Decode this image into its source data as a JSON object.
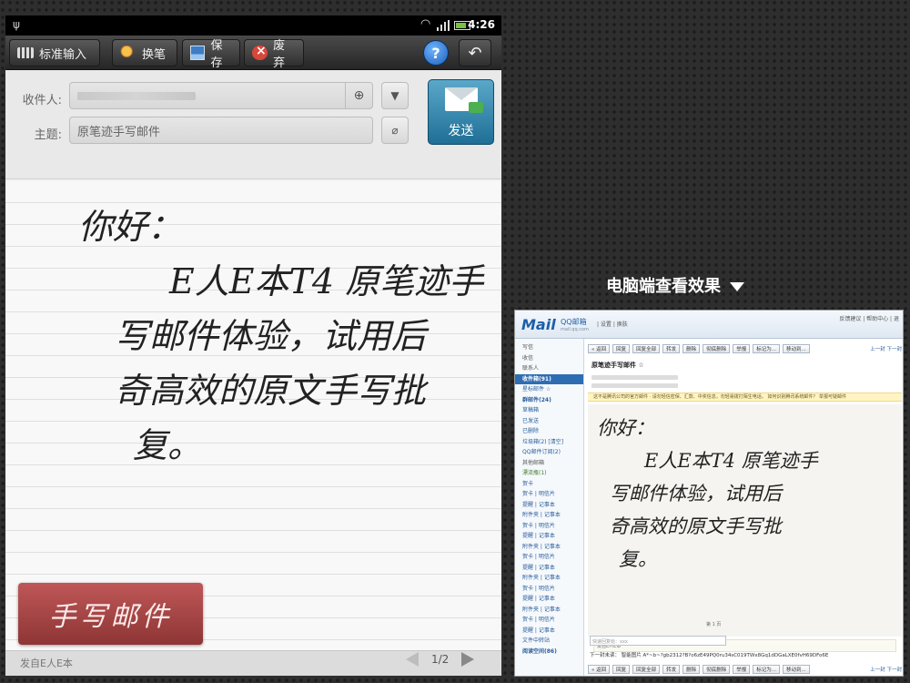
{
  "status_bar": {
    "time": "4:26"
  },
  "toolbar": {
    "input_mode": "标准输入",
    "change_pen": "换笔",
    "save": "保存",
    "discard": "废弃",
    "help": "?"
  },
  "compose": {
    "to_label": "收件人:",
    "subject_label": "主题:",
    "subject_value": "原笔迹手写邮件",
    "send_label": "发送"
  },
  "handwriting": {
    "lines": [
      "你好：",
      "E人E本T4 原笔迹手",
      "写邮件体验，试用后",
      "奇高效的原文手写批",
      "复。"
    ]
  },
  "badge": "手写邮件",
  "footer": {
    "signature": "发自E人E本",
    "page": "1/2"
  },
  "caption": "电脑端查看效果",
  "pc_view": {
    "logo": "Mail",
    "logo_sub": "QQ邮箱",
    "logo_url": "mail.qq.com",
    "top_links": "| 设置 | 换肤",
    "top_right": "反馈建议 | 帮助中心 | 退",
    "sidebar": {
      "compose": "写信",
      "receive": "收信",
      "contacts": "联系人",
      "inbox": "收件箱(91)",
      "starred": "星标邮件 ☆",
      "group": "群邮件(24)",
      "drafts": "草稿箱",
      "sent": "已发送",
      "deleted": "已删除",
      "spam": "垃圾箱(2)",
      "spam_clear": "[清空]",
      "subscriptions": "QQ邮件订阅(2)",
      "other": "其他邮箱",
      "notes": "漂流瓶(1)",
      "greeting": "贺卡",
      "filetrans": "文件中转站",
      "reading": "阅读空间(86)",
      "repeat_items": [
        "贺卡 | 明信片",
        "提醒 | 记事本",
        "附件夹 | 记事本",
        "贺卡 | 明信片",
        "提醒 | 记事本",
        "附件夹 | 记事本",
        "贺卡 | 明信片",
        "提醒 | 记事本",
        "附件夹 | 记事本",
        "贺卡 | 明信片",
        "提醒 | 记事本",
        "附件夹 | 记事本",
        "贺卡 | 明信片",
        "提醒 | 记事本"
      ]
    },
    "toolbar": [
      "« 返回",
      "回复",
      "回复全部",
      "转发",
      "删除",
      "彻底删除",
      "举报",
      "标记为...",
      "移动到...",
      "上一封 下一封"
    ],
    "subject": "原笔迹手写邮件 ☆",
    "notice": "这不是腾讯公司的官方邮件 · 请勿轻信密保、汇款、中奖信息，勿轻易拨打陌生电话。 如何识别腾讯系统邮件？  举报可疑邮件",
    "handwriting": [
      "你好：",
      "E人E本T4 原笔迹手",
      "写邮件体验，试用后",
      "奇高效的原文手写批",
      "复。"
    ],
    "page": "第 1 页",
    "signature": "发自E人E本",
    "reply_placeholder": "快速回复给：xxx",
    "next_mail": "下一封未读：  智能图片  A*~b~?gb2312?B?o6zE49PQ0ru34sC019TWx8Gq1dDGaLXE0fvH69DFo6E"
  }
}
